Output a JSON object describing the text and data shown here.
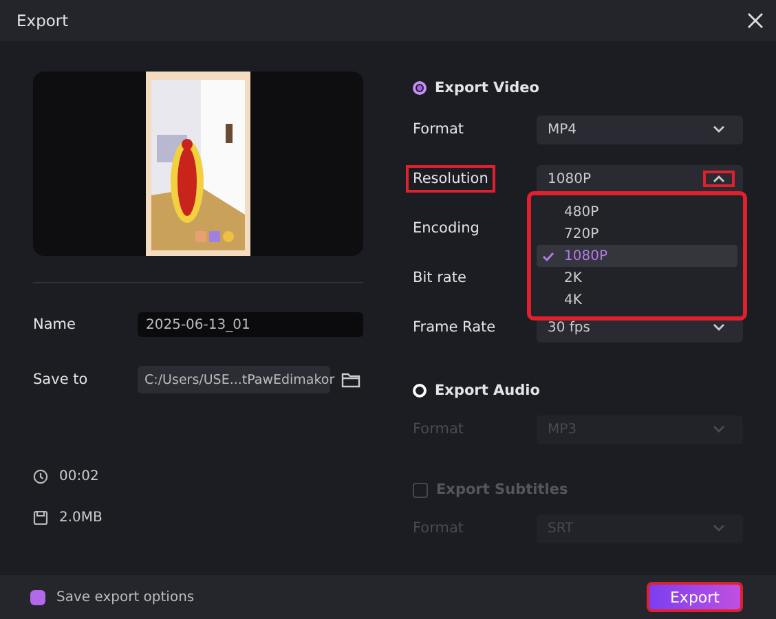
{
  "window": {
    "title": "Export"
  },
  "name_field": {
    "label": "Name",
    "value": "2025-06-13_01"
  },
  "save_to": {
    "label": "Save to",
    "value": "C:/Users/USE...tPawEdimakor"
  },
  "info": [
    {
      "kind": "duration",
      "text": "00:02"
    },
    {
      "kind": "size",
      "text": "2.0MB"
    }
  ],
  "sections": [
    {
      "title": "Export Video",
      "kind": "radio",
      "checked": true,
      "disabled": false,
      "rows": [
        {
          "label": "Format",
          "value": "MP4",
          "highlighted": false
        },
        {
          "label": "Resolution",
          "value": "1080P",
          "highlighted": true,
          "open": true,
          "options": [
            {
              "label": "480P",
              "selected": false
            },
            {
              "label": "720P",
              "selected": false
            },
            {
              "label": "1080P",
              "selected": true
            },
            {
              "label": "2K",
              "selected": false
            },
            {
              "label": "4K",
              "selected": false
            }
          ]
        },
        {
          "label": "Encoding",
          "highlighted": false
        },
        {
          "label": "Bit rate",
          "highlighted": false
        },
        {
          "label": "Frame Rate",
          "value": "30 fps",
          "highlighted": false
        }
      ]
    },
    {
      "title": "Export Audio",
      "kind": "radio",
      "checked": false,
      "disabled": false,
      "rows": [
        {
          "label": "Format",
          "value": "MP3",
          "highlighted": false
        }
      ]
    },
    {
      "title": "Export Subtitles",
      "kind": "checkbox",
      "checked": false,
      "disabled": true,
      "rows": [
        {
          "label": "Format",
          "value": "SRT",
          "highlighted": false
        }
      ]
    }
  ],
  "footer": {
    "save_options": {
      "label": "Save export options",
      "checked": true
    },
    "export_button": {
      "label": "Export",
      "highlighted": true
    }
  }
}
